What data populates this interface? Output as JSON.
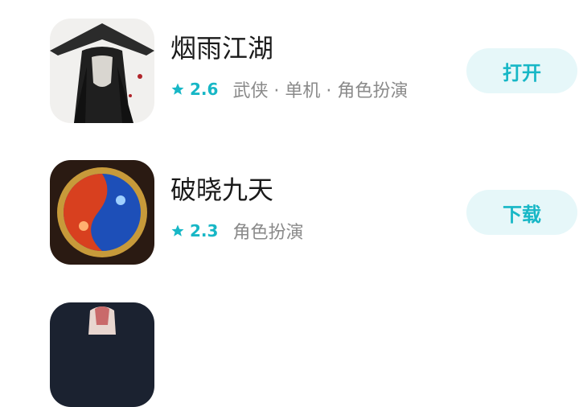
{
  "apps": [
    {
      "title": "烟雨江湖",
      "rating": "2.6",
      "tags": "武侠 · 单机 · 角色扮演",
      "action": "打开",
      "icon": "ink-swordsman-icon"
    },
    {
      "title": "破晓九天",
      "rating": "2.3",
      "tags": "角色扮演",
      "action": "下载",
      "icon": "fire-ice-orb-icon"
    },
    {
      "icon": "warrior-portrait-icon"
    }
  ],
  "colors": {
    "accent": "#17b7c6",
    "button_bg": "#e6f7f9",
    "title": "#1a1a1a",
    "tags": "#8a8a8a"
  }
}
